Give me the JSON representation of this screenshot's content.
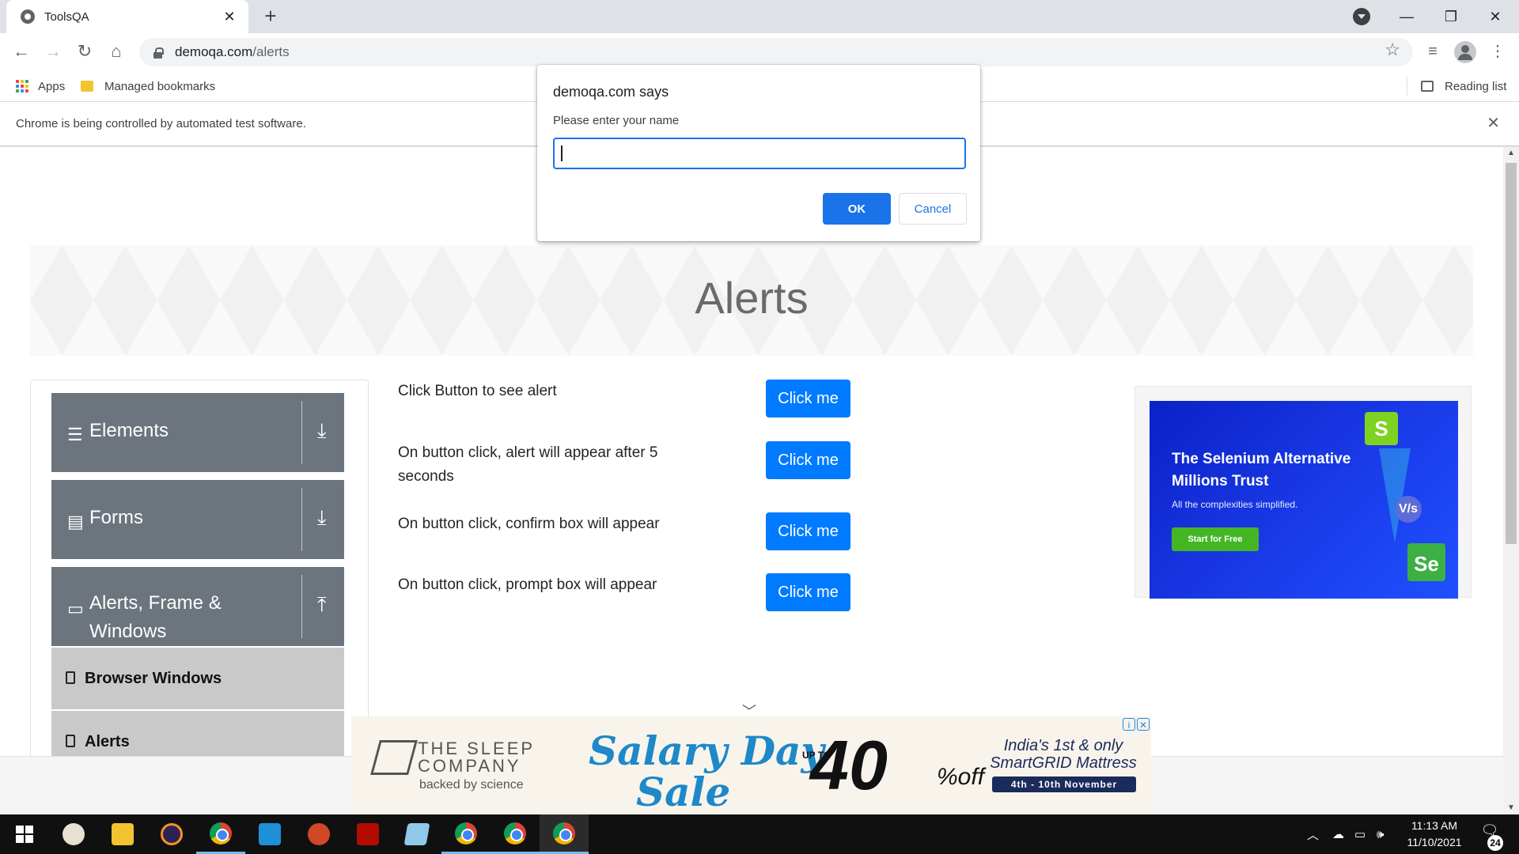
{
  "browser": {
    "tab_title": "ToolsQA",
    "tab_close": "✕",
    "new_tab": "+",
    "url_host": "demoqa.com",
    "url_path": "/alerts",
    "bookmarks": {
      "apps": "Apps",
      "managed": "Managed bookmarks",
      "reading_list": "Reading list"
    },
    "infobar_text": "Chrome is being controlled by automated test software.",
    "infobar_close": "✕",
    "icons": {
      "back": "←",
      "forward": "→",
      "reload": "↻",
      "home": "⌂",
      "star": "☆",
      "media": "≡",
      "menu": "⋮",
      "minimize": "—",
      "restore": "❐",
      "close": "✕"
    }
  },
  "dialog": {
    "title": "demoqa.com says",
    "message": "Please enter your name",
    "input_value": "",
    "ok_label": "OK",
    "cancel_label": "Cancel"
  },
  "page": {
    "title": "Alerts",
    "sidebar": {
      "groups": [
        {
          "label": "Elements",
          "icon": "☰",
          "arrow": "⤓"
        },
        {
          "label": "Forms",
          "icon": "▤",
          "arrow": "⤓"
        },
        {
          "label": "Alerts, Frame & Windows",
          "icon": "▭",
          "arrow": "⤒"
        }
      ],
      "items": [
        {
          "label": "Browser Windows"
        },
        {
          "label": "Alerts"
        }
      ]
    },
    "rows": [
      {
        "label": "Click Button to see alert",
        "button": "Click me"
      },
      {
        "label": "On button click, alert will appear after 5 seconds",
        "button": "Click me"
      },
      {
        "label": "On button click, confirm box will appear",
        "button": "Click me"
      },
      {
        "label": "On button click, prompt box will appear",
        "button": "Click me"
      }
    ],
    "ad_right": {
      "headline": "The Selenium Alternative Millions Trust",
      "subtext": "All the complexities simplified.",
      "cta": "Start for Free",
      "logo_s": "S",
      "logo_se": "Se",
      "vs": "V/s"
    },
    "ad_bottom": {
      "brand_line1": "THE SLEEP",
      "brand_line2": "COMPANY",
      "brand_tag": "backed by science",
      "salary_line1": "Salary Day",
      "salary_line2": "Sale",
      "upto": "UP TO",
      "percent": "40",
      "percent_off": "%off",
      "india_line1": "India's 1st & only",
      "india_line2": "SmartGRID Mattress",
      "dates": "4th - 10th November",
      "info_icon": "i",
      "close_icon": "✕"
    }
  },
  "taskbar": {
    "time": "11:13 AM",
    "date": "11/10/2021",
    "notification_count": "24"
  }
}
